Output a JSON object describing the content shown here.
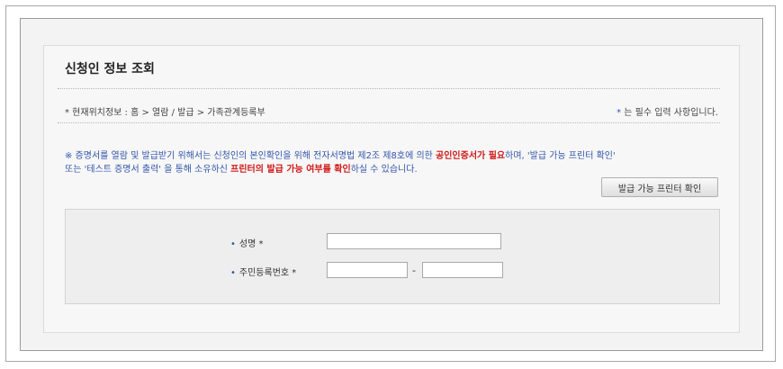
{
  "header": {
    "title": "신청인 정보 조회"
  },
  "breadcrumb": {
    "prefix": "* 현재위치정보 : ",
    "path": "홈 > 열람 / 발급 > 가족관계등록부"
  },
  "required_note": {
    "star": "*",
    "text": " 는 필수 입력 사항입니다."
  },
  "notice": {
    "part1": "※ 증명서를 열람 및 발급받기 위해서는 신청인의 본인확인을 위해 전자서명법 제2조 제8호에 의한 ",
    "red1": "공인인증서가 필요",
    "part2": "하며, '발급 가능 프린터 확인'",
    "part3": "또는 '테스트 증명서 출력' 을 통해 소유하신 ",
    "red2": "프린터의 발급 가능 여부를 확인",
    "part4": "하실 수 있습니다."
  },
  "buttons": {
    "check_printer": "발급 가능 프린터 확인"
  },
  "form": {
    "bullet": "•",
    "name_label": "성명 *",
    "rrn_label": "주민등록번호 *",
    "rrn_separator": "-",
    "name_value": "",
    "rrn_front_value": "",
    "rrn_back_value": ""
  }
}
